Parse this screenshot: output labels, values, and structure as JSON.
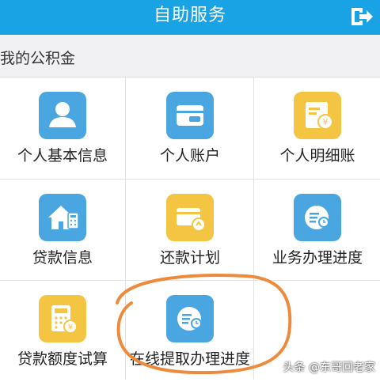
{
  "header": {
    "title": "自助服务",
    "exit_icon": "exit-icon",
    "color": "#1aa3e4"
  },
  "section": {
    "label": "我的公积金"
  },
  "menu": [
    {
      "label": "个人基本信息",
      "icon": "person-icon",
      "color": "#4aa6e0"
    },
    {
      "label": "个人账户",
      "icon": "wallet-icon",
      "color": "#4aa6e0"
    },
    {
      "label": "个人明细账",
      "icon": "ledger-icon",
      "color": "#f4c542"
    },
    {
      "label": "贷款信息",
      "icon": "house-icon",
      "color": "#4aa6e0"
    },
    {
      "label": "还款计划",
      "icon": "repayment-card-icon",
      "color": "#f4c542"
    },
    {
      "label": "业务办理进度",
      "icon": "progress-icon",
      "color": "#4aa6e0"
    },
    {
      "label": "贷款额度试算",
      "icon": "calculator-icon",
      "color": "#f4c542"
    },
    {
      "label": "在线提取办理进度",
      "icon": "progress-icon",
      "color": "#4aa6e0"
    }
  ],
  "highlight_color": "#ee8a3c",
  "watermark": "头条 @东哥回老家"
}
